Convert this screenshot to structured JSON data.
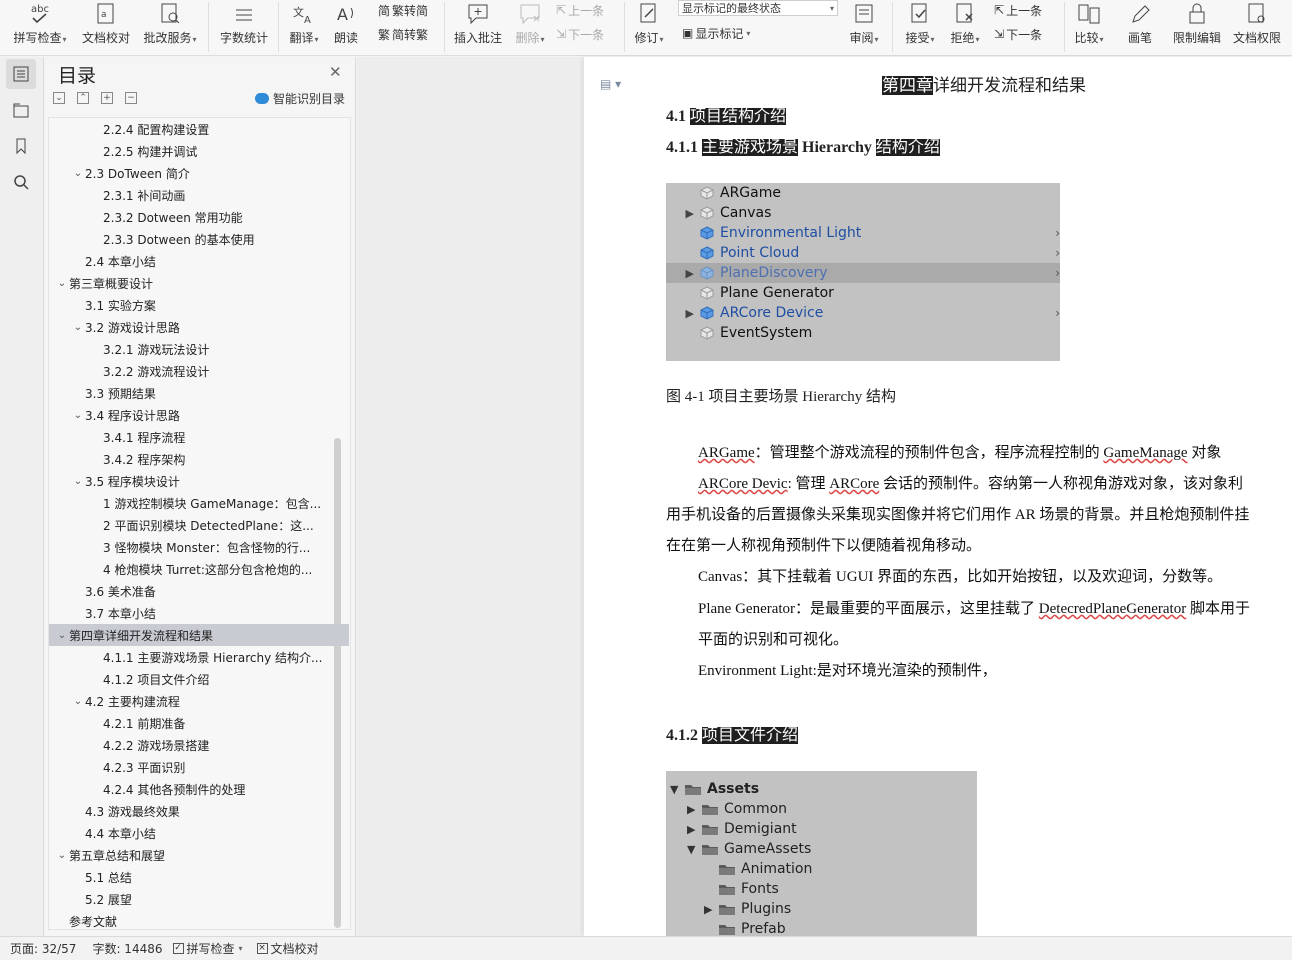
{
  "ribbon": {
    "spell_check": "拼写检查",
    "doc_proof": "文档校对",
    "batch_service": "批改服务",
    "word_count": "字数统计",
    "translate": "翻译",
    "read_aloud": "朗读",
    "trad_convert": "繁转简",
    "simp_convert": "简转繁",
    "insert_comment": "插入批注",
    "delete": "删除",
    "prev_comment": "上一条",
    "next_comment": "下一条",
    "revise": "修订",
    "markup_state": "显示标记的最终状态",
    "show_markup": "显示标记",
    "review": "审阅",
    "accept": "接受",
    "reject": "拒绝",
    "prev_change": "上一条",
    "next_change": "下一条",
    "compare": "比较",
    "pen": "画笔",
    "restrict_edit": "限制编辑",
    "doc_permission": "文档权限"
  },
  "toc": {
    "title": "目录",
    "smart_label": "智能识别目录",
    "items": [
      {
        "text": "2.2.4 配置构建设置",
        "level": 3
      },
      {
        "text": "2.2.5 构建并调试",
        "level": 3
      },
      {
        "text": "2.3 DoTween 简介",
        "level": 2,
        "toggle": "v"
      },
      {
        "text": "2.3.1 补间动画",
        "level": 3
      },
      {
        "text": "2.3.2 Dotween 常用功能",
        "level": 3
      },
      {
        "text": "2.3.3 Dotween 的基本使用",
        "level": 3
      },
      {
        "text": "2.4 本章小结",
        "level": 2
      },
      {
        "text": "第三章概要设计",
        "level": 1,
        "toggle": "v"
      },
      {
        "text": "3.1 实验方案",
        "level": 2
      },
      {
        "text": "3.2 游戏设计思路",
        "level": 2,
        "toggle": "v"
      },
      {
        "text": "3.2.1 游戏玩法设计",
        "level": 3
      },
      {
        "text": "3.2.2 游戏流程设计",
        "level": 3
      },
      {
        "text": "3.3 预期结果",
        "level": 2
      },
      {
        "text": "3.4 程序设计思路",
        "level": 2,
        "toggle": "v"
      },
      {
        "text": "3.4.1 程序流程",
        "level": 3
      },
      {
        "text": "3.4.2 程序架构",
        "level": 3
      },
      {
        "text": "3.5 程序模块设计",
        "level": 2,
        "toggle": "v"
      },
      {
        "text": "1 游戏控制模块 GameManage：包含...",
        "level": 3
      },
      {
        "text": "2 平面识别模块 DetectedPlane：这...",
        "level": 3
      },
      {
        "text": "3 怪物模块 Monster：包含怪物的行...",
        "level": 3
      },
      {
        "text": "4 枪炮模块 Turret:这部分包含枪炮的...",
        "level": 3
      },
      {
        "text": "3.6 美术准备",
        "level": 2
      },
      {
        "text": "3.7 本章小结",
        "level": 2
      },
      {
        "text": "第四章详细开发流程和结果",
        "level": 1,
        "toggle": "v",
        "selected": true
      },
      {
        "text": "4.1.1 主要游戏场景 Hierarchy 结构介...",
        "level": 3
      },
      {
        "text": "4.1.2 项目文件介绍",
        "level": 3
      },
      {
        "text": "4.2 主要构建流程",
        "level": 2,
        "toggle": "v"
      },
      {
        "text": "4.2.1 前期准备",
        "level": 3
      },
      {
        "text": "4.2.2 游戏场景搭建",
        "level": 3
      },
      {
        "text": "4.2.3 平面识别",
        "level": 3
      },
      {
        "text": "4.2.4 其他各预制件的处理",
        "level": 3
      },
      {
        "text": "4.3 游戏最终效果",
        "level": 2
      },
      {
        "text": "4.4 本章小结",
        "level": 2
      },
      {
        "text": "第五章总结和展望",
        "level": 1,
        "toggle": "v"
      },
      {
        "text": "5.1 总结",
        "level": 2
      },
      {
        "text": "5.2 展望",
        "level": 2
      },
      {
        "text": "参考文献",
        "level": 1
      }
    ]
  },
  "doc": {
    "chapter_hl": "第四章",
    "chapter_rest": "详细开发流程和结果",
    "h41_num": "4.1 ",
    "h41_text": "项目结构介绍",
    "h411_num": "4.1.1 ",
    "h411_a": "主要游戏场景",
    "h411_b": " Hierarchy ",
    "h411_c": "结构介绍",
    "hierarchy": [
      {
        "name": "ARGame",
        "cube": "gray",
        "arrow": false,
        "style": "normal"
      },
      {
        "name": "Canvas",
        "cube": "gray",
        "arrow": true,
        "style": "normal"
      },
      {
        "name": "Environmental Light",
        "cube": "blue",
        "arrow": false,
        "style": "blue",
        "more": true
      },
      {
        "name": "Point Cloud",
        "cube": "blue",
        "arrow": false,
        "style": "blue",
        "more": true
      },
      {
        "name": "PlaneDiscovery",
        "cube": "faded",
        "arrow": true,
        "style": "faded",
        "more": true,
        "selected": true
      },
      {
        "name": "Plane Generator",
        "cube": "gray",
        "arrow": false,
        "style": "normal"
      },
      {
        "name": "ARCore Device",
        "cube": "blue",
        "arrow": true,
        "style": "blue",
        "more": true
      },
      {
        "name": "EventSystem",
        "cube": "gray",
        "arrow": false,
        "style": "normal"
      }
    ],
    "fig41_caption": "图 4-1 项目主要场景 Hierarchy 结构",
    "p1_a": "ARGame",
    "p1_b": "：管理整个游戏流程的预制件包含，程序流程控制的 ",
    "p1_c": "GameManage",
    "p1_d": " 对象",
    "p2_a": "ARCore Devic",
    "p2_b": ": 管理 ",
    "p2_c": "ARCore",
    "p2_d": " 会话的预制件。容纳第一人称视角游戏对象，该对象利",
    "p2_line2": "用手机设备的后置摄像头采集现实图像并将它们用作 AR 场景的背景。并且枪炮预制件挂",
    "p2_line3": "在在第一人称视角预制件下以便随着视角移动。",
    "p3": "Canvas：其下挂载着 UGUI 界面的东西，比如开始按钮，以及欢迎词，分数等。",
    "p4_a": "Plane Generator：是最重要的平面展示，这里挂载了 ",
    "p4_b": "DetecredPlaneGenerator",
    "p4_c": " 脚本用于",
    "p4_line2": "平面的识别和可视化。",
    "p5": "Environment Light:是对环境光渲染的预制件，",
    "h412_num": "4.1.2 ",
    "h412_text": "项目文件介绍",
    "assets": [
      {
        "name": "Assets",
        "indent": 0,
        "arrow": "▼",
        "bold": true
      },
      {
        "name": "Common",
        "indent": 1,
        "arrow": "▶"
      },
      {
        "name": "Demigiant",
        "indent": 1,
        "arrow": "▶"
      },
      {
        "name": "GameAssets",
        "indent": 1,
        "arrow": "▼"
      },
      {
        "name": "Animation",
        "indent": 2,
        "arrow": ""
      },
      {
        "name": "Fonts",
        "indent": 2,
        "arrow": ""
      },
      {
        "name": "Plugins",
        "indent": 2,
        "arrow": "▶"
      },
      {
        "name": "Prefab",
        "indent": 2,
        "arrow": ""
      }
    ]
  },
  "status": {
    "page": "页面: 32/57",
    "words": "字数: 14486",
    "spell": "拼写检查",
    "proof": "文档校对"
  },
  "colors": {
    "highlight_bg": "#1f1f1f",
    "unity_bg": "#c2c2c2",
    "unity_blue": "#1f4ea3",
    "toc_selected": "#c8ccd2"
  }
}
